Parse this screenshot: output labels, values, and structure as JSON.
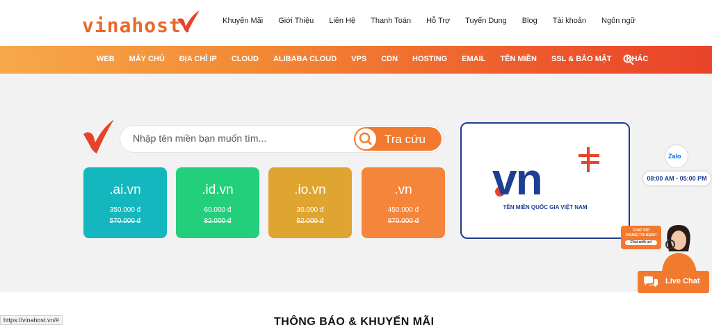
{
  "logo": {
    "text": "vinahost."
  },
  "top_nav": [
    "Khuyến Mãi",
    "Giới Thiệu",
    "Liên Hệ",
    "Thanh Toán",
    "Hỗ Trợ",
    "Tuyển Dụng",
    "Blog",
    "Tài khoản",
    "Ngôn ngữ"
  ],
  "main_nav": [
    "WEB",
    "MÁY CHỦ",
    "ĐỊA CHỈ IP",
    "CLOUD",
    "ALIBABA CLOUD",
    "VPS",
    "CDN",
    "HOSTING",
    "EMAIL",
    "TÊN MIỀN",
    "SSL & BẢO MẬT",
    "KHÁC"
  ],
  "search": {
    "placeholder": "Nhập tên miền bạn muốn tìm...",
    "button": "Tra cứu"
  },
  "domains": [
    {
      "ext": ".ai.vn",
      "price": "350.000 đ",
      "old_price": "570.000 đ",
      "color": "#14b7be"
    },
    {
      "ext": ".id.vn",
      "price": "60.000 đ",
      "old_price": "82.000 đ",
      "color": "#24cf7b"
    },
    {
      "ext": ".io.vn",
      "price": "30.000 đ",
      "old_price": "52.000 đ",
      "color": "#e0a431"
    },
    {
      "ext": ".vn",
      "price": "450.000 đ",
      "old_price": "670.000 đ",
      "color": "#f5853a"
    }
  ],
  "vn_banner": {
    "logo": "vn",
    "subtitle": "TÊN MIỀN QUỐC GIA VIỆT NAM"
  },
  "zalo": {
    "label": "Zalo",
    "hours": "08:00 AM - 05:00 PM"
  },
  "chat_promo": {
    "line1": "CHAT VỚI",
    "line2": "CHÚNG TÔI NGAY!",
    "line3": "Chat with us!"
  },
  "live_chat": {
    "label": "Live Chat"
  },
  "section_title": "THÔNG BÁO & KHUYẾN MÃI",
  "status_url": "https://vinahost.vn/#",
  "colors": {
    "brand_orange": "#f27a2e",
    "brand_red": "#e8432a",
    "navy": "#1c3f93"
  }
}
